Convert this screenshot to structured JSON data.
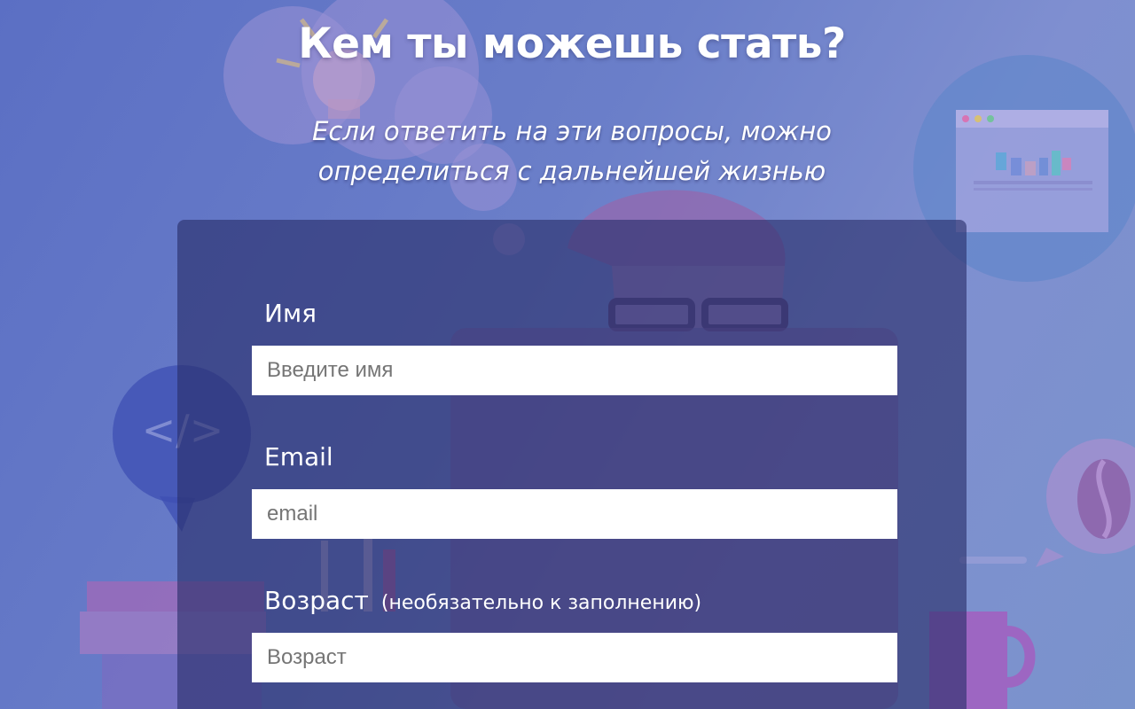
{
  "header": {
    "title": "Кем ты можешь стать?",
    "subtitle_line1": "Если ответить на эти вопросы, можно",
    "subtitle_line2": "определиться с дальнейшей жизнью"
  },
  "form": {
    "name": {
      "label": "Имя",
      "placeholder": "Введите имя",
      "value": ""
    },
    "email": {
      "label": "Email",
      "placeholder": "email",
      "value": ""
    },
    "age": {
      "label": "Возраст",
      "hint": "(необязательно к заполнению)",
      "placeholder": "Возраст",
      "value": ""
    }
  },
  "background": {
    "code_bubble_text": "</>",
    "icons": [
      "lightbulb-icon",
      "code-icon",
      "coffee-bean-icon",
      "chart-window-icon",
      "person-with-glasses",
      "books-icon",
      "pencil-cup-icon",
      "coffee-mug-icon"
    ]
  },
  "colors": {
    "background": "#6b7fc9",
    "card": "#2c3069",
    "input": "#ffffff",
    "text": "#ffffff"
  }
}
